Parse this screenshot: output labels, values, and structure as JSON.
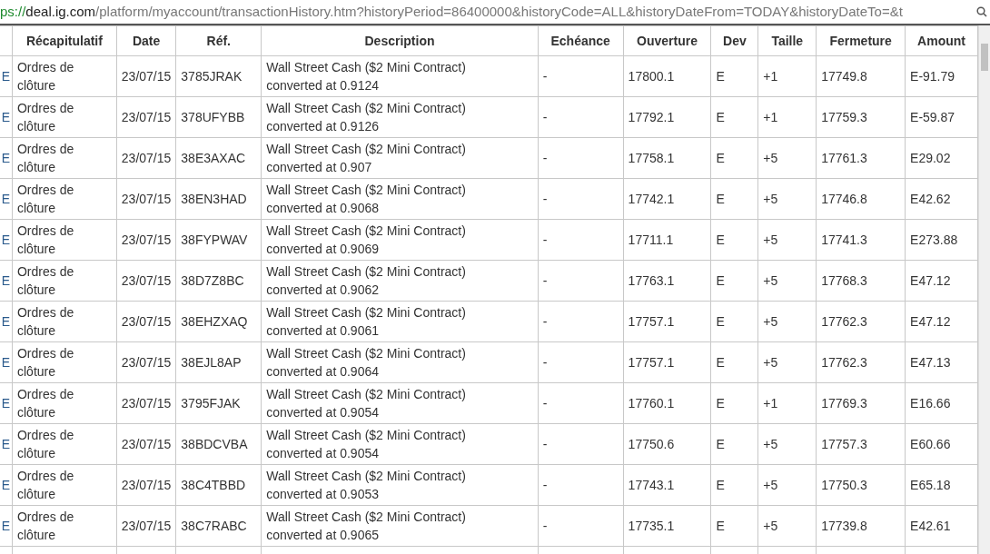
{
  "address_bar": {
    "scheme": "ps://",
    "domain": "deal.ig.com",
    "path": "/platform/myaccount/transactionHistory.htm?historyPeriod=86400000&historyCode=ALL&historyDateFrom=TODAY&historyDateTo=&t"
  },
  "table": {
    "columns": [
      "Récapitulatif",
      "Date",
      "Réf.",
      "Description",
      "Echéance",
      "Ouverture",
      "Dev",
      "Taille",
      "Fermeture",
      "Amount"
    ],
    "rows": [
      {
        "column_0": "E",
        "cells": [
          "Ordres de clôture",
          "23/07/15",
          "3785JRAK",
          "Wall Street Cash ($2 Mini Contract) converted at 0.9124",
          "-",
          "17800.1",
          "E",
          "+1",
          "17749.8",
          "E-91.79"
        ]
      },
      {
        "column_0": "E",
        "cells": [
          "Ordres de clôture",
          "23/07/15",
          "378UFYBB",
          "Wall Street Cash ($2 Mini Contract) converted at 0.9126",
          "-",
          "17792.1",
          "E",
          "+1",
          "17759.3",
          "E-59.87"
        ]
      },
      {
        "column_0": "E",
        "cells": [
          "Ordres de clôture",
          "23/07/15",
          "38E3AXAC",
          "Wall Street Cash ($2 Mini Contract) converted at 0.907",
          "-",
          "17758.1",
          "E",
          "+5",
          "17761.3",
          "E29.02"
        ]
      },
      {
        "column_0": "E",
        "cells": [
          "Ordres de clôture",
          "23/07/15",
          "38EN3HAD",
          "Wall Street Cash ($2 Mini Contract) converted at 0.9068",
          "-",
          "17742.1",
          "E",
          "+5",
          "17746.8",
          "E42.62"
        ]
      },
      {
        "column_0": "E",
        "cells": [
          "Ordres de clôture",
          "23/07/15",
          "38FYPWAV",
          "Wall Street Cash ($2 Mini Contract) converted at 0.9069",
          "-",
          "17711.1",
          "E",
          "+5",
          "17741.3",
          "E273.88"
        ]
      },
      {
        "column_0": "E",
        "cells": [
          "Ordres de clôture",
          "23/07/15",
          "38D7Z8BC",
          "Wall Street Cash ($2 Mini Contract) converted at 0.9062",
          "-",
          "17763.1",
          "E",
          "+5",
          "17768.3",
          "E47.12"
        ]
      },
      {
        "column_0": "E",
        "cells": [
          "Ordres de clôture",
          "23/07/15",
          "38EHZXAQ",
          "Wall Street Cash ($2 Mini Contract) converted at 0.9061",
          "-",
          "17757.1",
          "E",
          "+5",
          "17762.3",
          "E47.12"
        ]
      },
      {
        "column_0": "E",
        "cells": [
          "Ordres de clôture",
          "23/07/15",
          "38EJL8AP",
          "Wall Street Cash ($2 Mini Contract) converted at 0.9064",
          "-",
          "17757.1",
          "E",
          "+5",
          "17762.3",
          "E47.13"
        ]
      },
      {
        "column_0": "E",
        "cells": [
          "Ordres de clôture",
          "23/07/15",
          "3795FJAK",
          "Wall Street Cash ($2 Mini Contract) converted at 0.9054",
          "-",
          "17760.1",
          "E",
          "+1",
          "17769.3",
          "E16.66"
        ]
      },
      {
        "column_0": "E",
        "cells": [
          "Ordres de clôture",
          "23/07/15",
          "38BDCVBA",
          "Wall Street Cash ($2 Mini Contract) converted at 0.9054",
          "-",
          "17750.6",
          "E",
          "+5",
          "17757.3",
          "E60.66"
        ]
      },
      {
        "column_0": "E",
        "cells": [
          "Ordres de clôture",
          "23/07/15",
          "38C4TBBD",
          "Wall Street Cash ($2 Mini Contract) converted at 0.9053",
          "-",
          "17743.1",
          "E",
          "+5",
          "17750.3",
          "E65.18"
        ]
      },
      {
        "column_0": "E",
        "cells": [
          "Ordres de clôture",
          "23/07/15",
          "38C7RABC",
          "Wall Street Cash ($2 Mini Contract) converted at 0.9065",
          "-",
          "17735.1",
          "E",
          "+5",
          "17739.8",
          "E42.61"
        ]
      }
    ]
  }
}
